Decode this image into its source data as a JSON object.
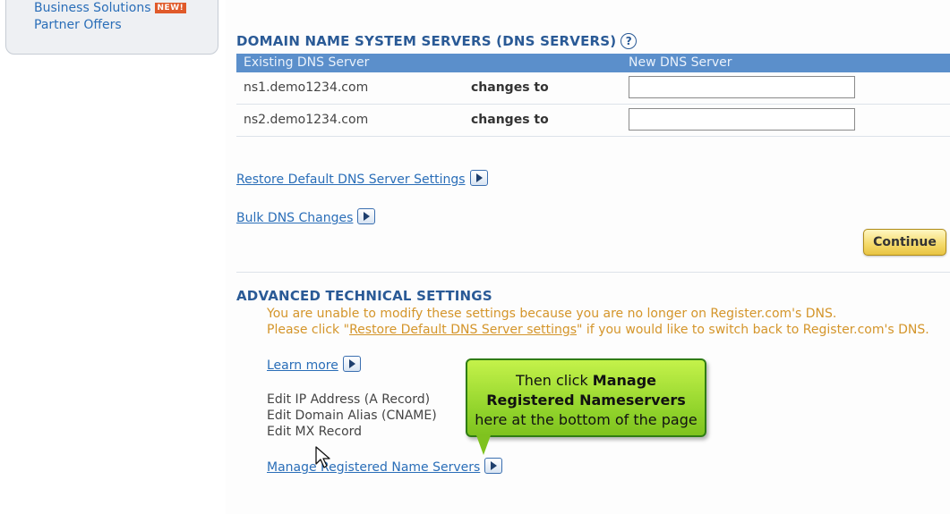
{
  "sidebar": {
    "business_solutions": "Business Solutions",
    "new_badge": "NEW!",
    "partner_offers": "Partner Offers"
  },
  "dns": {
    "title": "DOMAIN NAME SYSTEM SERVERS (DNS SERVERS)",
    "help_icon": "?",
    "col_existing": "Existing DNS Server",
    "col_new": "New DNS Server",
    "rows": [
      {
        "server": "ns1.demo1234.com",
        "changes": "changes to",
        "new_value": ""
      },
      {
        "server": "ns2.demo1234.com",
        "changes": "changes to",
        "new_value": ""
      }
    ],
    "restore_link": "Restore Default DNS Server Settings",
    "bulk_link": "Bulk DNS Changes",
    "continue_label": "Continue"
  },
  "advanced": {
    "title": "ADVANCED TECHNICAL SETTINGS",
    "warning_line1": "You are unable to modify these settings because you are no longer on Register.com's DNS.",
    "warning_pre": "Please click \"",
    "warning_link": "Restore Default DNS Server settings",
    "warning_post": "\" if you would like to switch back to Register.com's DNS.",
    "learn_more": "Learn more",
    "edit_a": "Edit IP Address (A Record)",
    "edit_cname": "Edit Domain Alias (CNAME)",
    "edit_mx": "Edit MX Record",
    "manage_link": "Manage Registered Name Servers"
  },
  "tooltip": {
    "line1_pre": "Then click ",
    "line1_bold": "Manage",
    "line2_bold": "Registered Nameservers",
    "line3": "here at the bottom of the page"
  },
  "colors": {
    "link": "#2a6eb8",
    "header_bg": "#5b8fcb",
    "warning": "#d4952a",
    "tooltip_green": "#8fd22a"
  }
}
